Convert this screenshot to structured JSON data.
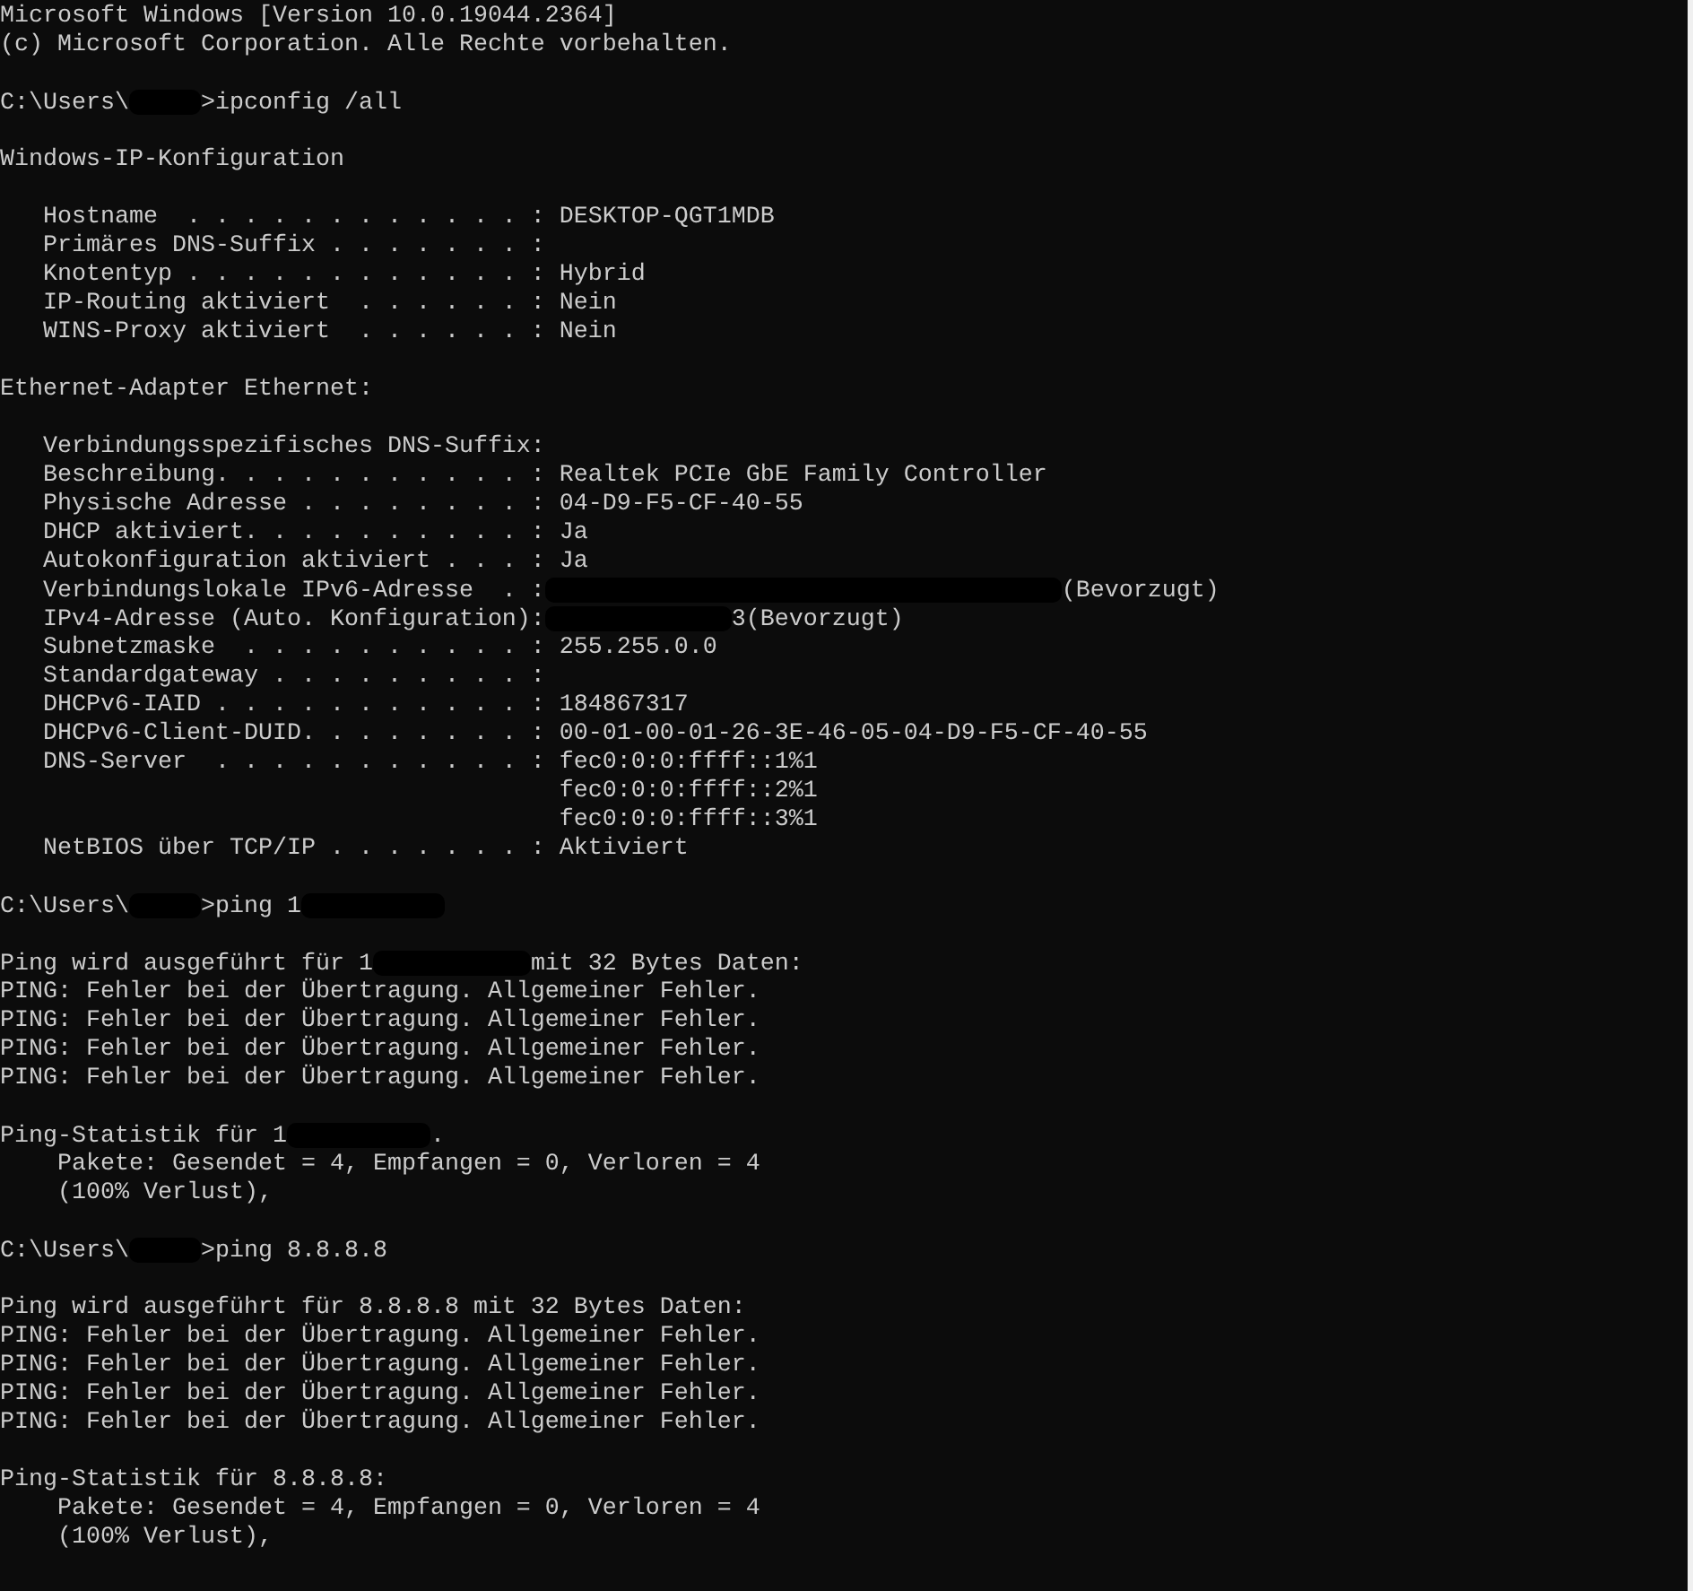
{
  "console": {
    "lines": [
      {
        "kind": "output",
        "segments": [
          {
            "kind": "text",
            "text": "Microsoft Windows [Version 10.0.19044.2364]"
          }
        ]
      },
      {
        "kind": "output",
        "segments": [
          {
            "kind": "text",
            "text": "(c) Microsoft Corporation. Alle Rechte vorbehalten."
          }
        ]
      },
      {
        "kind": "blank"
      },
      {
        "kind": "output",
        "segments": [
          {
            "kind": "text",
            "text": "C:\\Users\\"
          },
          {
            "kind": "redacted"
          },
          {
            "kind": "text",
            "text": "     >ipconfig /all"
          }
        ]
      },
      {
        "kind": "blank"
      },
      {
        "kind": "output",
        "segments": [
          {
            "kind": "text",
            "text": "Windows-IP-Konfiguration"
          }
        ]
      },
      {
        "kind": "blank"
      },
      {
        "kind": "output",
        "segments": [
          {
            "kind": "text",
            "text": "   Hostname  . . . . . . . . . . . . : DESKTOP-QGT1MDB"
          }
        ]
      },
      {
        "kind": "output",
        "segments": [
          {
            "kind": "text",
            "text": "   Primäres DNS-Suffix . . . . . . . :"
          }
        ]
      },
      {
        "kind": "output",
        "segments": [
          {
            "kind": "text",
            "text": "   Knotentyp . . . . . . . . . . . . : Hybrid"
          }
        ]
      },
      {
        "kind": "output",
        "segments": [
          {
            "kind": "text",
            "text": "   IP-Routing aktiviert  . . . . . . : Nein"
          }
        ]
      },
      {
        "kind": "output",
        "segments": [
          {
            "kind": "text",
            "text": "   WINS-Proxy aktiviert  . . . . . . : Nein"
          }
        ]
      },
      {
        "kind": "blank"
      },
      {
        "kind": "output",
        "segments": [
          {
            "kind": "text",
            "text": "Ethernet-Adapter Ethernet:"
          }
        ]
      },
      {
        "kind": "blank"
      },
      {
        "kind": "output",
        "segments": [
          {
            "kind": "text",
            "text": "   Verbindungsspezifisches DNS-Suffix:"
          }
        ]
      },
      {
        "kind": "output",
        "segments": [
          {
            "kind": "text",
            "text": "   Beschreibung. . . . . . . . . . . : Realtek PCIe GbE Family Controller"
          }
        ]
      },
      {
        "kind": "output",
        "segments": [
          {
            "kind": "text",
            "text": "   Physische Adresse . . . . . . . . : 04-D9-F5-CF-40-55"
          }
        ]
      },
      {
        "kind": "output",
        "segments": [
          {
            "kind": "text",
            "text": "   DHCP aktiviert. . . . . . . . . . : Ja"
          }
        ]
      },
      {
        "kind": "output",
        "segments": [
          {
            "kind": "text",
            "text": "   Autokonfiguration aktiviert . . . : Ja"
          }
        ]
      },
      {
        "kind": "output",
        "segments": [
          {
            "kind": "text",
            "text": "   Verbindungslokale IPv6-Adresse  . :"
          },
          {
            "kind": "redacted"
          },
          {
            "kind": "text",
            "text": "                                    (Bevorzugt)"
          }
        ]
      },
      {
        "kind": "output",
        "segments": [
          {
            "kind": "text",
            "text": "   IPv4-Adresse (Auto. Konfiguration):"
          },
          {
            "kind": "redacted"
          },
          {
            "kind": "text",
            "text": "             3(Bevorzugt)"
          }
        ]
      },
      {
        "kind": "output",
        "segments": [
          {
            "kind": "text",
            "text": "   Subnetzmaske  . . . . . . . . . . : 255.255.0.0"
          }
        ]
      },
      {
        "kind": "output",
        "segments": [
          {
            "kind": "text",
            "text": "   Standardgateway . . . . . . . . . :"
          }
        ]
      },
      {
        "kind": "output",
        "segments": [
          {
            "kind": "text",
            "text": "   DHCPv6-IAID . . . . . . . . . . . : 184867317"
          }
        ]
      },
      {
        "kind": "output",
        "segments": [
          {
            "kind": "text",
            "text": "   DHCPv6-Client-DUID. . . . . . . . : 00-01-00-01-26-3E-46-05-04-D9-F5-CF-40-55"
          }
        ]
      },
      {
        "kind": "output",
        "segments": [
          {
            "kind": "text",
            "text": "   DNS-Server  . . . . . . . . . . . : fec0:0:0:ffff::1%1"
          }
        ]
      },
      {
        "kind": "output",
        "segments": [
          {
            "kind": "text",
            "text": "                                       fec0:0:0:ffff::2%1"
          }
        ]
      },
      {
        "kind": "output",
        "segments": [
          {
            "kind": "text",
            "text": "                                       fec0:0:0:ffff::3%1"
          }
        ]
      },
      {
        "kind": "output",
        "segments": [
          {
            "kind": "text",
            "text": "   NetBIOS über TCP/IP . . . . . . . : Aktiviert"
          }
        ]
      },
      {
        "kind": "blank"
      },
      {
        "kind": "output",
        "segments": [
          {
            "kind": "text",
            "text": "C:\\Users\\"
          },
          {
            "kind": "redacted"
          },
          {
            "kind": "text",
            "text": "     >ping 1          "
          },
          {
            "kind": "redacted"
          }
        ]
      },
      {
        "kind": "blank"
      },
      {
        "kind": "output",
        "segments": [
          {
            "kind": "text",
            "text": "Ping wird ausgeführt für 1"
          },
          {
            "kind": "redacted"
          },
          {
            "kind": "text",
            "text": "           mit 32 Bytes Daten:"
          }
        ]
      },
      {
        "kind": "output",
        "segments": [
          {
            "kind": "text",
            "text": "PING: Fehler bei der Übertragung. Allgemeiner Fehler."
          }
        ]
      },
      {
        "kind": "output",
        "segments": [
          {
            "kind": "text",
            "text": "PING: Fehler bei der Übertragung. Allgemeiner Fehler."
          }
        ]
      },
      {
        "kind": "output",
        "segments": [
          {
            "kind": "text",
            "text": "PING: Fehler bei der Übertragung. Allgemeiner Fehler."
          }
        ]
      },
      {
        "kind": "output",
        "segments": [
          {
            "kind": "text",
            "text": "PING: Fehler bei der Übertragung. Allgemeiner Fehler."
          }
        ]
      },
      {
        "kind": "blank"
      },
      {
        "kind": "output",
        "segments": [
          {
            "kind": "text",
            "text": "Ping-Statistik für 1"
          },
          {
            "kind": "redacted"
          },
          {
            "kind": "text",
            "text": "          ."
          }
        ]
      },
      {
        "kind": "output",
        "segments": [
          {
            "kind": "text",
            "text": "    Pakete: Gesendet = 4, Empfangen = 0, Verloren = 4"
          }
        ]
      },
      {
        "kind": "output",
        "segments": [
          {
            "kind": "text",
            "text": "    (100% Verlust),"
          }
        ]
      },
      {
        "kind": "blank"
      },
      {
        "kind": "output",
        "segments": [
          {
            "kind": "text",
            "text": "C:\\Users\\"
          },
          {
            "kind": "redacted"
          },
          {
            "kind": "text",
            "text": "     >ping 8.8.8.8"
          }
        ]
      },
      {
        "kind": "blank"
      },
      {
        "kind": "output",
        "segments": [
          {
            "kind": "text",
            "text": "Ping wird ausgeführt für 8.8.8.8 mit 32 Bytes Daten:"
          }
        ]
      },
      {
        "kind": "output",
        "segments": [
          {
            "kind": "text",
            "text": "PING: Fehler bei der Übertragung. Allgemeiner Fehler."
          }
        ]
      },
      {
        "kind": "output",
        "segments": [
          {
            "kind": "text",
            "text": "PING: Fehler bei der Übertragung. Allgemeiner Fehler."
          }
        ]
      },
      {
        "kind": "output",
        "segments": [
          {
            "kind": "text",
            "text": "PING: Fehler bei der Übertragung. Allgemeiner Fehler."
          }
        ]
      },
      {
        "kind": "output",
        "segments": [
          {
            "kind": "text",
            "text": "PING: Fehler bei der Übertragung. Allgemeiner Fehler."
          }
        ]
      },
      {
        "kind": "blank"
      },
      {
        "kind": "output",
        "segments": [
          {
            "kind": "text",
            "text": "Ping-Statistik für 8.8.8.8:"
          }
        ]
      },
      {
        "kind": "output",
        "segments": [
          {
            "kind": "text",
            "text": "    Pakete: Gesendet = 4, Empfangen = 0, Verloren = 4"
          }
        ]
      },
      {
        "kind": "output",
        "segments": [
          {
            "kind": "text",
            "text": "    (100% Verlust),"
          }
        ]
      }
    ]
  }
}
